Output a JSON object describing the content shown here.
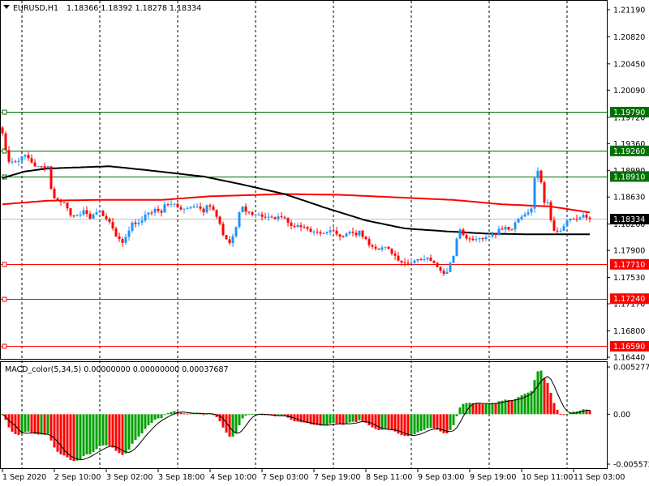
{
  "chart_data": {
    "type": "candlestick",
    "title": "EURUSD,H1",
    "ohlc_header": [
      "1.18366",
      "1.18392",
      "1.18278",
      "1.18334"
    ],
    "price_axis": {
      "ylim": [
        1.1644,
        1.2119
      ],
      "ticks": [
        "1.21190",
        "1.20820",
        "1.20450",
        "1.20090",
        "1.19720",
        "1.19360",
        "1.18990",
        "1.18630",
        "1.18260",
        "1.17900",
        "1.17530",
        "1.17170",
        "1.16800",
        "1.16440"
      ]
    },
    "time_axis": {
      "labels": [
        "1 Sep 2020",
        "2 Sep 10:00",
        "3 Sep 02:00",
        "3 Sep 18:00",
        "4 Sep 10:00",
        "7 Sep 03:00",
        "7 Sep 19:00",
        "8 Sep 11:00",
        "9 Sep 03:00",
        "9 Sep 19:00",
        "10 Sep 11:00",
        "11 Sep 03:00"
      ],
      "candles_per_label": 16,
      "grid_every_candles": 24,
      "candle_count": 182
    },
    "close_keyframes": [
      [
        0,
        1.195
      ],
      [
        1,
        1.1927
      ],
      [
        2,
        1.1911
      ],
      [
        4,
        1.1911
      ],
      [
        7,
        1.1922
      ],
      [
        8,
        1.1916
      ],
      [
        10,
        1.1905
      ],
      [
        14,
        1.1905
      ],
      [
        15,
        1.1872
      ],
      [
        16,
        1.1861
      ],
      [
        18,
        1.1856
      ],
      [
        19,
        1.1856
      ],
      [
        21,
        1.1839
      ],
      [
        23,
        1.1836
      ],
      [
        24,
        1.1839
      ],
      [
        25,
        1.1844
      ],
      [
        27,
        1.1836
      ],
      [
        29,
        1.1842
      ],
      [
        30,
        1.1844
      ],
      [
        32,
        1.1833
      ],
      [
        33,
        1.1828
      ],
      [
        34,
        1.182
      ],
      [
        35,
        1.1811
      ],
      [
        37,
        1.18
      ],
      [
        39,
        1.1817
      ],
      [
        40,
        1.1828
      ],
      [
        42,
        1.1828
      ],
      [
        44,
        1.1839
      ],
      [
        45,
        1.1839
      ],
      [
        47,
        1.1844
      ],
      [
        49,
        1.1844
      ],
      [
        50,
        1.1853
      ],
      [
        52,
        1.1853
      ],
      [
        54,
        1.1849
      ],
      [
        56,
        1.1847
      ],
      [
        58,
        1.1849
      ],
      [
        60,
        1.185
      ],
      [
        62,
        1.1842
      ],
      [
        63,
        1.1853
      ],
      [
        65,
        1.1847
      ],
      [
        66,
        1.1836
      ],
      [
        68,
        1.1811
      ],
      [
        70,
        1.18
      ],
      [
        72,
        1.1822
      ],
      [
        73,
        1.1842
      ],
      [
        74,
        1.185
      ],
      [
        75,
        1.1844
      ],
      [
        78,
        1.1839
      ],
      [
        80,
        1.1836
      ],
      [
        83,
        1.1836
      ],
      [
        84,
        1.1833
      ],
      [
        85,
        1.1839
      ],
      [
        88,
        1.1828
      ],
      [
        90,
        1.1822
      ],
      [
        93,
        1.1822
      ],
      [
        95,
        1.1817
      ],
      [
        98,
        1.1813
      ],
      [
        100,
        1.1815
      ],
      [
        102,
        1.1817
      ],
      [
        103,
        1.1811
      ],
      [
        104,
        1.1809
      ],
      [
        106,
        1.1813
      ],
      [
        107,
        1.1817
      ],
      [
        109,
        1.1811
      ],
      [
        110,
        1.1817
      ],
      [
        111,
        1.1811
      ],
      [
        113,
        1.18
      ],
      [
        114,
        1.1795
      ],
      [
        116,
        1.1791
      ],
      [
        118,
        1.1795
      ],
      [
        119,
        1.1791
      ],
      [
        121,
        1.178
      ],
      [
        122,
        1.1776
      ],
      [
        124,
        1.1773
      ],
      [
        126,
        1.1773
      ],
      [
        127,
        1.1776
      ],
      [
        128,
        1.1778
      ],
      [
        131,
        1.1778
      ],
      [
        133,
        1.1773
      ],
      [
        134,
        1.1767
      ],
      [
        136,
        1.1758
      ],
      [
        137,
        1.1762
      ],
      [
        139,
        1.1784
      ],
      [
        140,
        1.1806
      ],
      [
        141,
        1.1817
      ],
      [
        142,
        1.1811
      ],
      [
        144,
        1.1806
      ],
      [
        147,
        1.1805
      ],
      [
        149,
        1.1806
      ],
      [
        150,
        1.1809
      ],
      [
        152,
        1.1811
      ],
      [
        153,
        1.1817
      ],
      [
        155,
        1.182
      ],
      [
        157,
        1.1817
      ],
      [
        158,
        1.1828
      ],
      [
        160,
        1.1836
      ],
      [
        162,
        1.1842
      ],
      [
        163,
        1.185
      ],
      [
        164,
        1.1889
      ],
      [
        165,
        1.19
      ],
      [
        166,
        1.1883
      ],
      [
        167,
        1.1856
      ],
      [
        168,
        1.1856
      ],
      [
        169,
        1.1833
      ],
      [
        170,
        1.1817
      ],
      [
        172,
        1.1817
      ],
      [
        173,
        1.1822
      ],
      [
        174,
        1.1831
      ],
      [
        176,
        1.1833
      ],
      [
        179,
        1.1836
      ],
      [
        181,
        1.18334
      ]
    ],
    "ma_black_keyframes": [
      [
        0,
        1.1889
      ],
      [
        7,
        1.1898
      ],
      [
        14,
        1.1902
      ],
      [
        33,
        1.1905
      ],
      [
        44,
        1.19
      ],
      [
        62,
        1.1891
      ],
      [
        74,
        1.188
      ],
      [
        87,
        1.1867
      ],
      [
        99,
        1.1849
      ],
      [
        112,
        1.1831
      ],
      [
        124,
        1.182
      ],
      [
        137,
        1.1816
      ],
      [
        149,
        1.1813
      ],
      [
        162,
        1.1812
      ],
      [
        181,
        1.1812
      ]
    ],
    "ma_red_keyframes": [
      [
        0,
        1.1853
      ],
      [
        14,
        1.1858
      ],
      [
        29,
        1.1859
      ],
      [
        49,
        1.1859
      ],
      [
        64,
        1.1864
      ],
      [
        87,
        1.1867
      ],
      [
        104,
        1.1866
      ],
      [
        124,
        1.1862
      ],
      [
        139,
        1.1859
      ],
      [
        154,
        1.1853
      ],
      [
        169,
        1.185
      ],
      [
        181,
        1.1842
      ]
    ],
    "levels": [
      {
        "value": 1.1979,
        "label": "1.19790",
        "color": "#007000"
      },
      {
        "value": 1.1926,
        "label": "1.19260",
        "color": "#007000"
      },
      {
        "value": 1.1891,
        "label": "1.18910",
        "color": "#007000"
      },
      {
        "value": 1.1771,
        "label": "1.17710",
        "color": "#ff0000"
      },
      {
        "value": 1.1724,
        "label": "1.17240",
        "color": "#ff0000"
      },
      {
        "value": 1.1659,
        "label": "1.16590",
        "color": "#ff0000"
      }
    ],
    "current_price": {
      "value": 1.18334,
      "label": "1.18334"
    },
    "macd": {
      "title": "MACD_color(5,34,5) 0.00000000 0.00000000 0.00037687",
      "fast": 5,
      "slow": 34,
      "signal": 5,
      "ylim": [
        -0.005572,
        0.005277
      ],
      "ticks": [
        "0.0052770",
        "0.00",
        "-0.005572"
      ]
    },
    "colors": {
      "up": "#1e90ff",
      "down": "#ff0000",
      "grid": "#000000",
      "macd_up": "#00a000",
      "macd_down": "#ff0000"
    }
  }
}
